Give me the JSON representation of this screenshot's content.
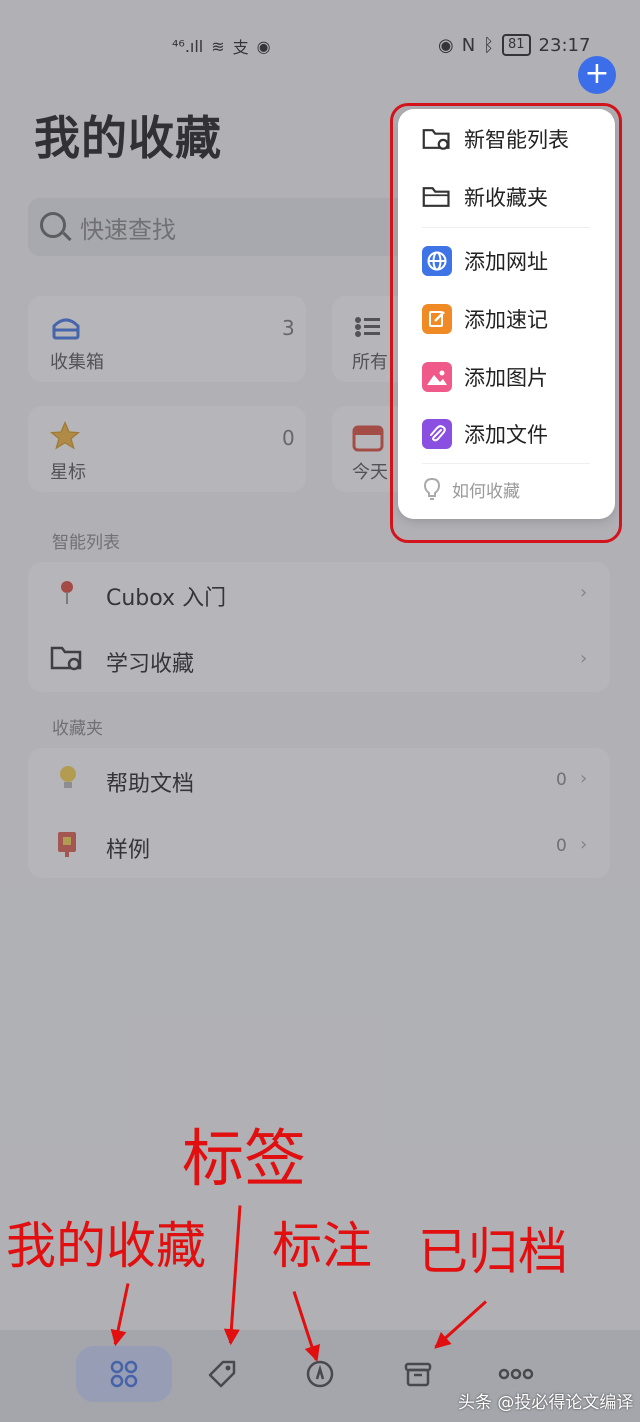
{
  "status_bar": {
    "network": "⁴⁶.ıll",
    "time": "23:17",
    "battery": "81"
  },
  "header": {
    "title": "我的收藏",
    "add_label": "+"
  },
  "search": {
    "placeholder": "快速查找"
  },
  "cards": [
    {
      "label": "收集箱",
      "count": "3",
      "icon": "inbox-icon"
    },
    {
      "label": "所有",
      "count": "",
      "icon": "list-icon"
    },
    {
      "label": "星标",
      "count": "0",
      "icon": "star-icon"
    },
    {
      "label": "今天",
      "count": "",
      "icon": "calendar-icon"
    }
  ],
  "smart_lists": {
    "label": "智能列表",
    "items": [
      {
        "label": "Cubox 入门",
        "icon": "pin-icon"
      },
      {
        "label": "学习收藏",
        "icon": "smart-folder-icon"
      }
    ]
  },
  "folders": {
    "label": "收藏夹",
    "items": [
      {
        "label": "帮助文档",
        "count": "0",
        "icon": "lightbulb-icon"
      },
      {
        "label": "样例",
        "count": "0",
        "icon": "bookmark-icon"
      }
    ]
  },
  "menu": {
    "items": [
      {
        "label": "新智能列表",
        "icon": "smart-folder-icon"
      },
      {
        "label": "新收藏夹",
        "icon": "folder-icon"
      },
      {
        "label": "添加网址",
        "icon": "globe-icon",
        "color": "#3f74e6"
      },
      {
        "label": "添加速记",
        "icon": "note-icon",
        "color": "#f08a24"
      },
      {
        "label": "添加图片",
        "icon": "image-icon",
        "color": "#f05a8a"
      },
      {
        "label": "添加文件",
        "icon": "paperclip-icon",
        "color": "#8a4fe0"
      }
    ],
    "help_label": "如何收藏"
  },
  "tabs": [
    {
      "name": "collections",
      "icon": "grid-icon",
      "active": true
    },
    {
      "name": "tags",
      "icon": "tag-icon"
    },
    {
      "name": "annotations",
      "icon": "annotation-icon"
    },
    {
      "name": "archive",
      "icon": "archive-icon"
    },
    {
      "name": "more",
      "icon": "more-icon"
    }
  ],
  "annotations": {
    "collections": "我的收藏",
    "tags": "标签",
    "notes": "标注",
    "archived": "已归档"
  },
  "watermark": "头条 @投必得论文编译",
  "colors": {
    "accent": "#3b6ee8",
    "annotation": "#e10f0f"
  }
}
